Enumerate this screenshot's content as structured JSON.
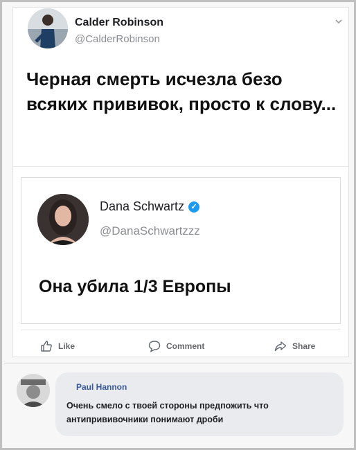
{
  "post": {
    "author_name": "Calder Robinson",
    "author_handle": "@CalderRobinson",
    "text": "Черная смерть исчезла безо всяких прививок, просто к слову..."
  },
  "quoted_post": {
    "author_name": "Dana Schwartz",
    "verified_mark": "✓",
    "author_handle": "@DanaSchwartzzz",
    "text": "Она убила 1/3 Европы"
  },
  "actions": {
    "like_label": "Like",
    "comment_label": "Comment",
    "share_label": "Share"
  },
  "comment": {
    "author_name": "Paul Hannon",
    "text": "Очень смело с твоей стороны предпожить что антипрививочники понимают дроби"
  },
  "colors": {
    "verified": "#1d9bf0",
    "link_name": "#385898",
    "bubble": "#e9ebee",
    "muted": "#8a8d91"
  },
  "icons": [
    "chevron-down-icon",
    "verified-badge-icon",
    "thumbs-up-icon",
    "speech-bubble-icon",
    "share-arrow-icon"
  ]
}
